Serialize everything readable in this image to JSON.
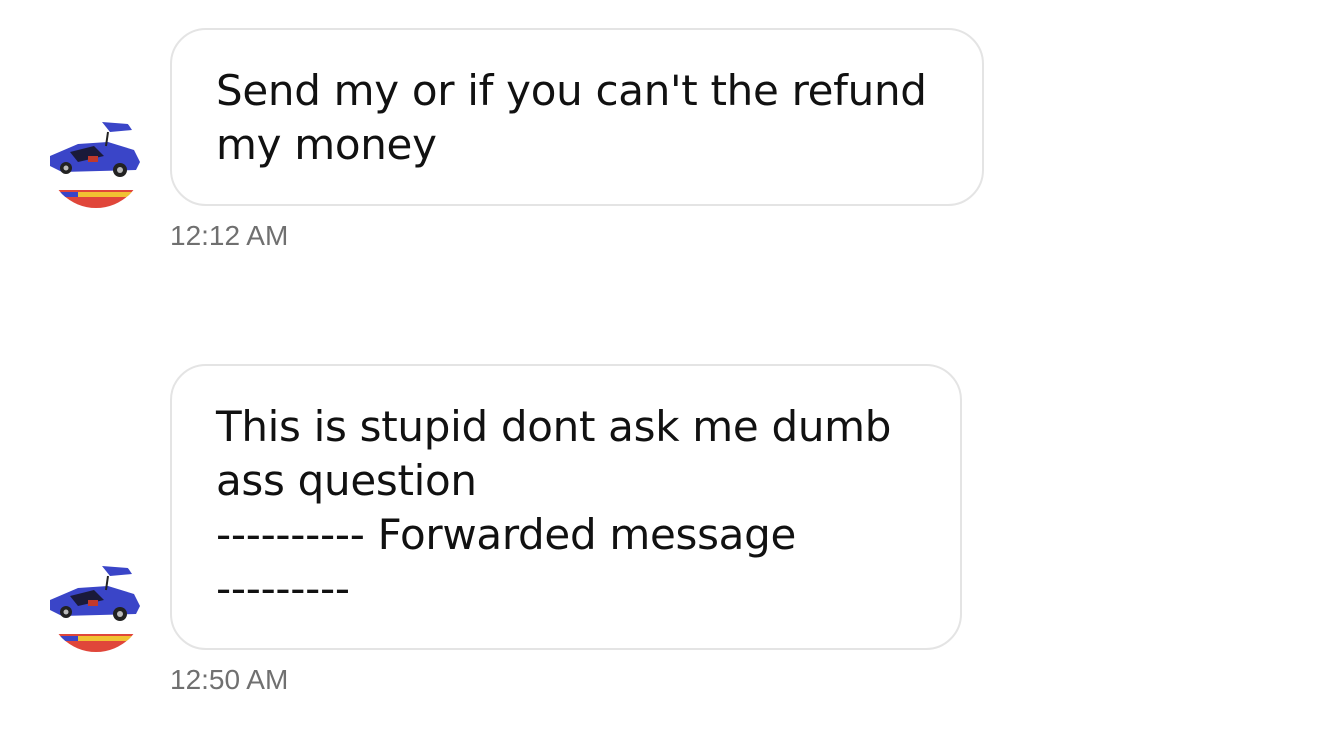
{
  "messages": [
    {
      "lines": [
        "Send my or if you can't the refund",
        "my money"
      ],
      "time": "12:12 AM"
    },
    {
      "lines": [
        "This is stupid dont ask me dumb",
        "ass question",
        "---------- Forwarded message",
        "---------"
      ],
      "time": "12:50 AM"
    }
  ],
  "avatar": {
    "icon": "car-avatar-icon",
    "colors": {
      "car": "#3a45c8",
      "stripe_red": "#e0463a",
      "stripe_yellow": "#f1c232",
      "stripe_blue": "#3a45c8"
    }
  }
}
